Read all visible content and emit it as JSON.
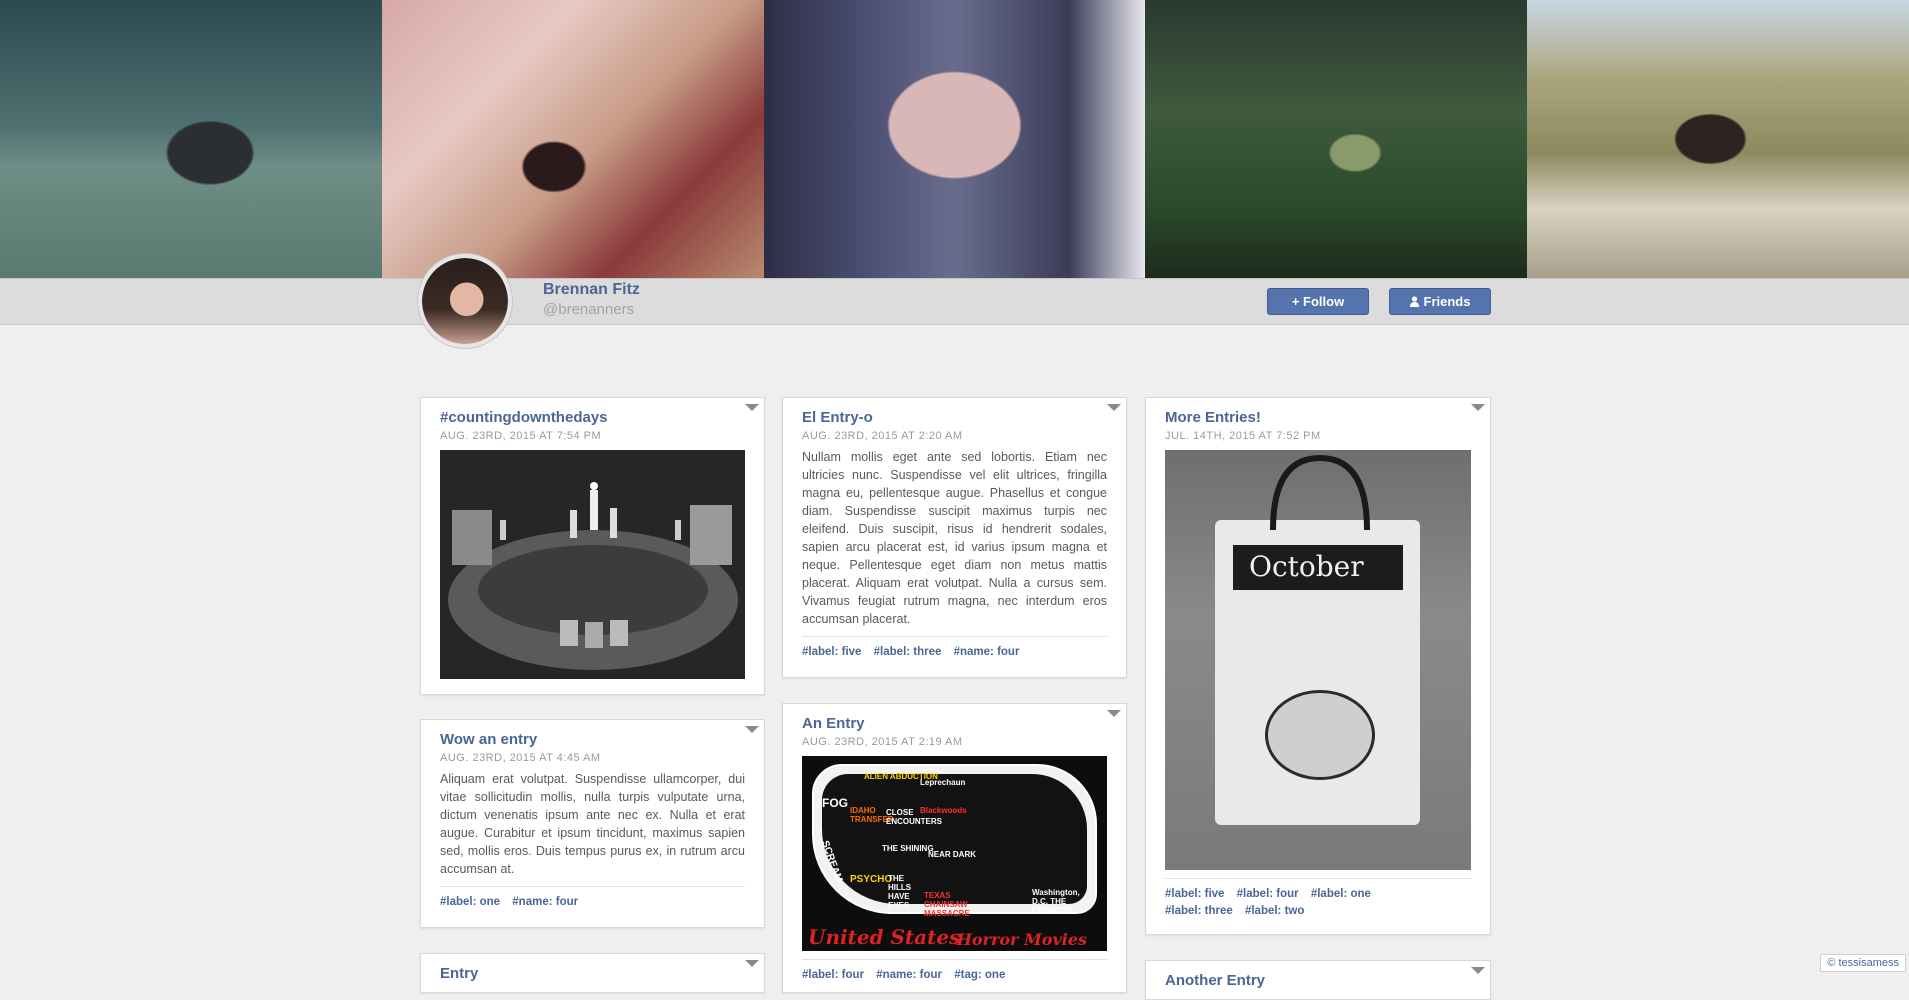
{
  "profile": {
    "name": "Brennan Fitz",
    "handle": "@brenanners",
    "follow_label": "+ Follow",
    "friends_label": "Friends"
  },
  "entries": [
    {
      "title": "#countingdownthedays",
      "date": "AUG. 23RD, 2015 AT 7:54 PM",
      "image": "candles-ouija-board"
    },
    {
      "title": "El Entry-o",
      "date": "AUG. 23RD, 2015 AT 2:20 AM",
      "body": "Nullam mollis eget ante sed lobortis. Etiam nec ultricies nunc. Suspendisse vel elit ultrices, fringilla magna eu, pellentesque augue. Phasellus et congue diam. Suspendisse suscipit maximus turpis nec eleifend. Duis suscipit, risus id hendrerit sodales, sapien arcu placerat est, id varius ipsum magna et neque. Pellentesque eget diam non metus mattis placerat. Aliquam erat volutpat. Nulla a cursus sem. Vivamus feugiat rutrum magna, nec interdum eros accumsan placerat.",
      "tags": [
        "#label: five",
        "#label: three",
        "#name: four"
      ]
    },
    {
      "title": "More Entries!",
      "date": "JUL. 14TH, 2015 AT 7:52 PM",
      "image": "october-sketchbook",
      "image_text": "October",
      "tags": [
        "#label: five",
        "#label: four",
        "#label: one",
        "#label: three",
        "#label: two"
      ]
    },
    {
      "title": "Wow an entry",
      "date": "AUG. 23RD, 2015 AT 4:45 AM",
      "body": "Aliquam erat volutpat. Suspendisse ullamcorper, dui vitae sollicitudin mollis, nulla turpis vulputate urna, dictum venenatis ipsum ante nec ex. Nulla et erat augue. Curabitur et ipsum tincidunt, maximus sapien sed, mollis eros. Duis tempus purus ex, in rutrum arcu accumsan at.",
      "tags": [
        "#label: one",
        "#name: four"
      ]
    },
    {
      "title": "An Entry",
      "date": "AUG. 23RD, 2015 AT 2:19 AM",
      "image": "horror-movie-map",
      "image_text": {
        "title": "United States",
        "subtitle": "Horror Movies",
        "labels": [
          "ALIEN ABDUCTION",
          "Leprechaun",
          "FOG",
          "IDAHO TRANSFER",
          "CLOSE ENCOUNTERS",
          "Blackwoods",
          "SCREAM",
          "THE SHINING",
          "NEAR DARK",
          "PSYCHO",
          "THE HILLS HAVE EYES",
          "TEXAS CHAINSAW MASSACRE",
          "Washington, D.C. THE EXORCIST"
        ]
      },
      "tags": [
        "#label: four",
        "#name: four",
        "#tag: one"
      ]
    },
    {
      "title": "Entry"
    },
    {
      "title": "Another Entry"
    }
  ],
  "watermark": "© tessisamess",
  "colors": {
    "accent": "#4a6696",
    "button": "#5574ad",
    "page_bg": "#efefef"
  }
}
